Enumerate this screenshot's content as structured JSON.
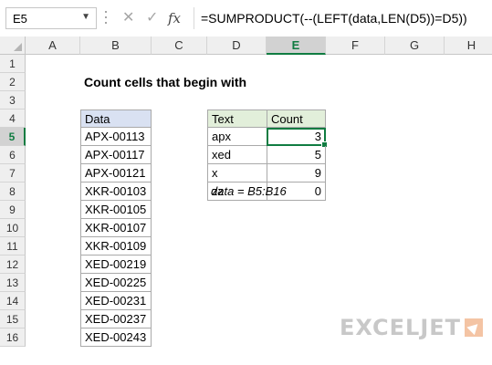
{
  "formula_bar": {
    "name_box": "E5",
    "formula": "=SUMPRODUCT(--(LEFT(data,LEN(D5))=D5))"
  },
  "columns": [
    "A",
    "B",
    "C",
    "D",
    "E",
    "F",
    "G",
    "H"
  ],
  "active_column": "E",
  "rows": [
    "1",
    "2",
    "3",
    "4",
    "5",
    "6",
    "7",
    "8",
    "9",
    "10",
    "11",
    "12",
    "13",
    "14",
    "15",
    "16"
  ],
  "active_row": "5",
  "sheet": {
    "title": "Count cells that begin with",
    "data_header": "Data",
    "data_values": [
      "APX-00113",
      "APX-00117",
      "APX-00121",
      "XKR-00103",
      "XKR-00105",
      "XKR-00107",
      "XKR-00109",
      "XED-00219",
      "XED-00225",
      "XED-00231",
      "XED-00237",
      "XED-00243"
    ],
    "table_headers": [
      "Text",
      "Count"
    ],
    "table_rows": [
      {
        "text": "apx",
        "count": "3"
      },
      {
        "text": "xed",
        "count": "5"
      },
      {
        "text": "x",
        "count": "9"
      },
      {
        "text": "zz",
        "count": "0"
      }
    ],
    "named_range_note": "data = B5:B16"
  },
  "logo": {
    "text": "EXCELJET"
  },
  "colors": {
    "selection": "#107c41",
    "data_header_bg": "#d9e1f2",
    "table_header_bg": "#e2efda"
  }
}
